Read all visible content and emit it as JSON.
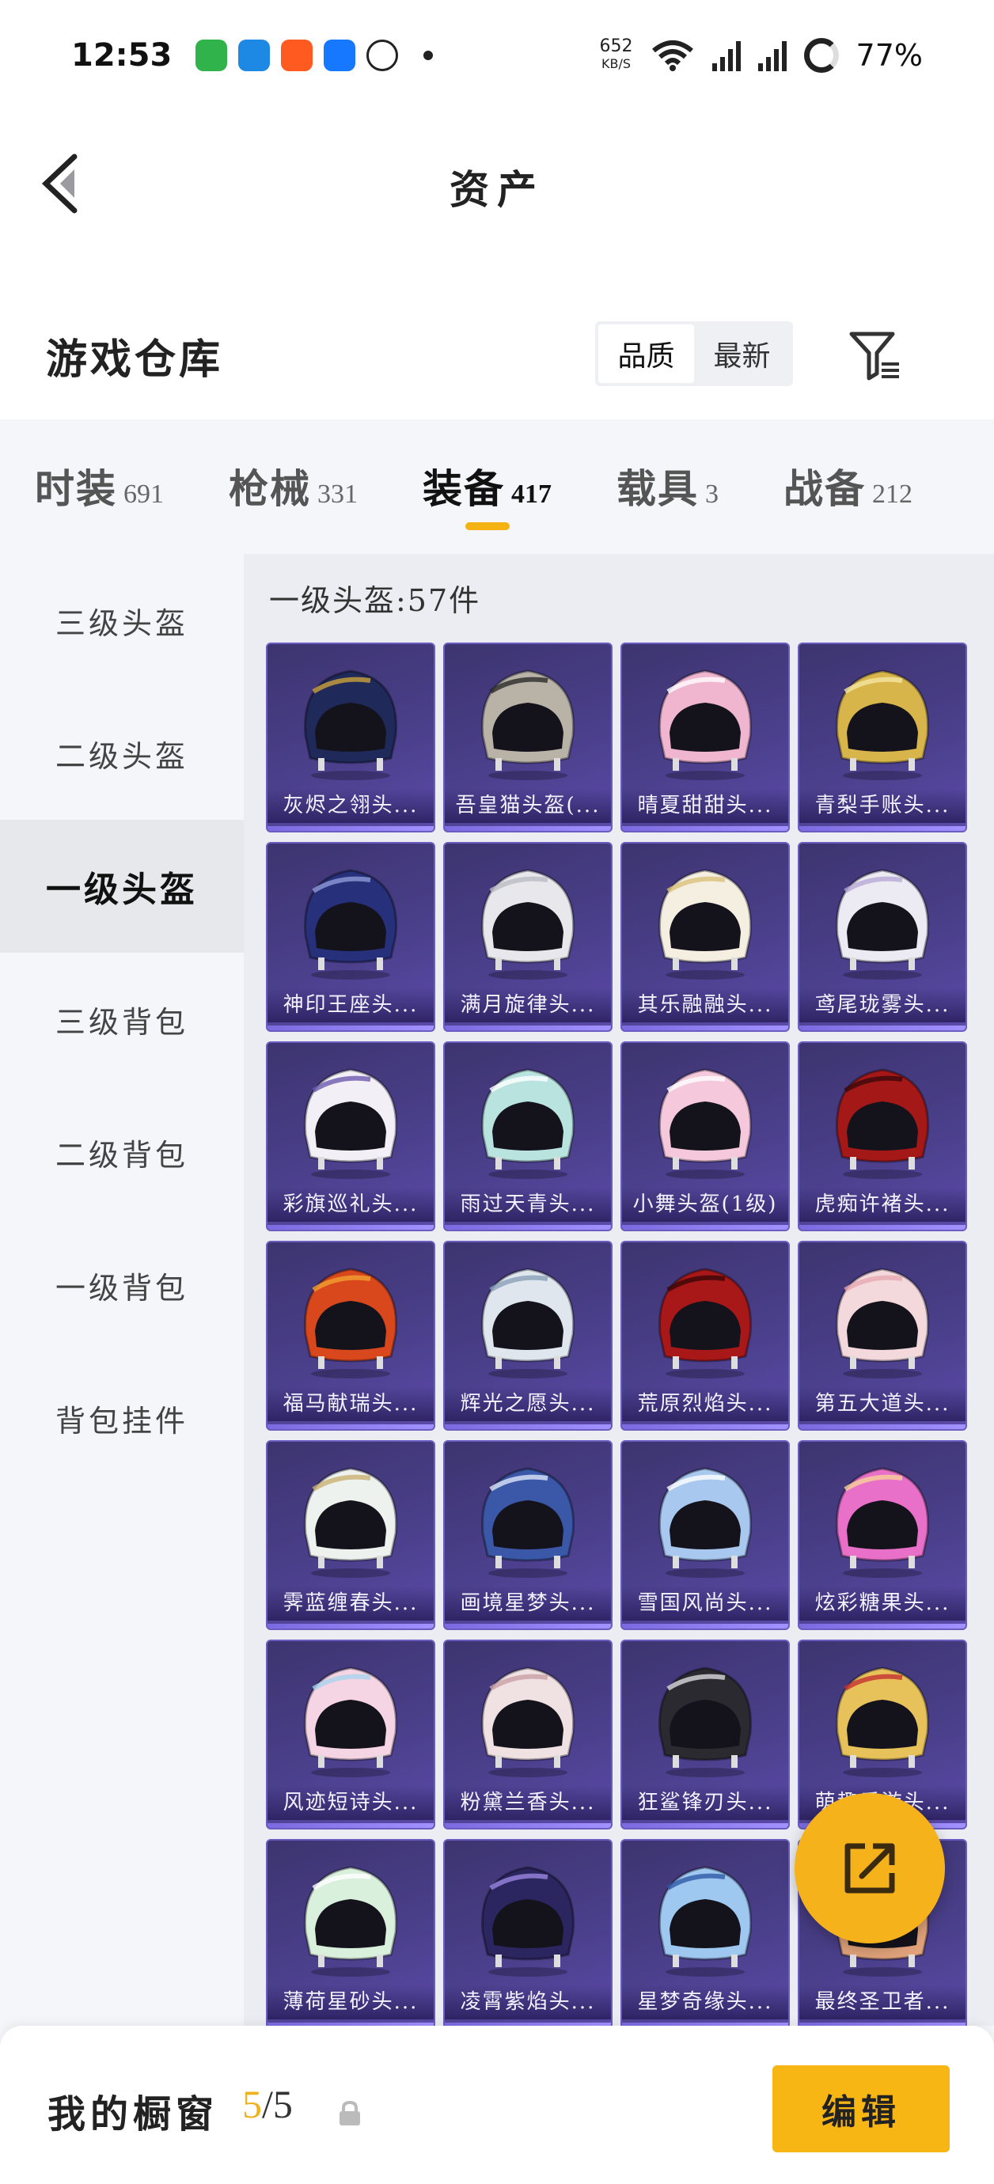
{
  "status_bar": {
    "time": "12:53",
    "speed_value": "652",
    "speed_unit": "KB/S",
    "battery": "77%"
  },
  "header": {
    "title": "资产"
  },
  "warehouse": {
    "title": "游戏仓库",
    "sort_options": [
      "品质",
      "最新"
    ],
    "active_sort": "品质"
  },
  "category_tabs": [
    {
      "label": "时装",
      "count": "691"
    },
    {
      "label": "枪械",
      "count": "331"
    },
    {
      "label": "装备",
      "count": "417"
    },
    {
      "label": "载具",
      "count": "3"
    },
    {
      "label": "战备",
      "count": "212"
    }
  ],
  "active_category": "装备",
  "sidebar": {
    "items": [
      "三级头盔",
      "二级头盔",
      "一级头盔",
      "三级背包",
      "二级背包",
      "一级背包",
      "背包挂件"
    ],
    "active": "一级头盔"
  },
  "content": {
    "header": "一级头盔:57件",
    "items": [
      {
        "name": "灰烬之翎头...",
        "color": "#1f2a5a",
        "accent": "#c9a23a"
      },
      {
        "name": "吾皇猫头盔(...",
        "color": "#b9b2a6",
        "accent": "#2b2b2b"
      },
      {
        "name": "晴夏甜甜头...",
        "color": "#f0b6cf",
        "accent": "#ffffff"
      },
      {
        "name": "青梨手账头...",
        "color": "#d8b54a",
        "accent": "#f4e7a2"
      },
      {
        "name": "神印王座头...",
        "color": "#27307a",
        "accent": "#8f9ad8"
      },
      {
        "name": "满月旋律头...",
        "color": "#e8e8ec",
        "accent": "#b9bac4"
      },
      {
        "name": "其乐融融头...",
        "color": "#f5efe2",
        "accent": "#d9c07a"
      },
      {
        "name": "鸢尾珑雾头...",
        "color": "#eceaf2",
        "accent": "#b8a9d6"
      },
      {
        "name": "彩旗巡礼头...",
        "color": "#f2f0f6",
        "accent": "#6b5ab0"
      },
      {
        "name": "雨过天青头...",
        "color": "#b9e3df",
        "accent": "#ffffff"
      },
      {
        "name": "小舞头盔(1级)",
        "color": "#f5c8dc",
        "accent": "#ffffff"
      },
      {
        "name": "虎痴许褚头...",
        "color": "#a51818",
        "accent": "#3b0a0a"
      },
      {
        "name": "福马献瑞头...",
        "color": "#d9481c",
        "accent": "#f0a030"
      },
      {
        "name": "辉光之愿头...",
        "color": "#dfe6ee",
        "accent": "#8aa0b8"
      },
      {
        "name": "荒原烈焰头...",
        "color": "#a81818",
        "accent": "#3a0808"
      },
      {
        "name": "第五大道头...",
        "color": "#f3d9dc",
        "accent": "#e7a9b3"
      },
      {
        "name": "霁蓝缠春头...",
        "color": "#eef2ee",
        "accent": "#c9b070"
      },
      {
        "name": "画境星梦头...",
        "color": "#3a57a8",
        "accent": "#dfe6f7"
      },
      {
        "name": "雪国风尚头...",
        "color": "#a9c8ef",
        "accent": "#ffffff"
      },
      {
        "name": "炫彩糖果头...",
        "color": "#e870c8",
        "accent": "#f8d29a"
      },
      {
        "name": "风迹短诗头...",
        "color": "#f5d5e3",
        "accent": "#a7d3ee"
      },
      {
        "name": "粉黛兰香头...",
        "color": "#f0e2e2",
        "accent": "#c9a0a8"
      },
      {
        "name": "狂鲨锋刃头...",
        "color": "#2a2a30",
        "accent": "#d9d9de"
      },
      {
        "name": "萌趣乐游头...",
        "color": "#e7c25b",
        "accent": "#c53030"
      },
      {
        "name": "薄荷星砂头...",
        "color": "#d9f0dc",
        "accent": "#ffffff"
      },
      {
        "name": "凌霄紫焰头...",
        "color": "#2c2660",
        "accent": "#9a86e0"
      },
      {
        "name": "星梦奇缘头...",
        "color": "#9fc8f0",
        "accent": "#2f5aa8"
      },
      {
        "name": "最终圣卫者...",
        "color": "#e0a27a",
        "accent": "#ffffff"
      }
    ]
  },
  "bottom_bar": {
    "showcase_label": "我的橱窗",
    "showcase_current": "5",
    "showcase_total": "/5",
    "edit_label": "编辑"
  },
  "colors": {
    "accent": "#f5b313",
    "card_bg": "#4a3f8a"
  }
}
